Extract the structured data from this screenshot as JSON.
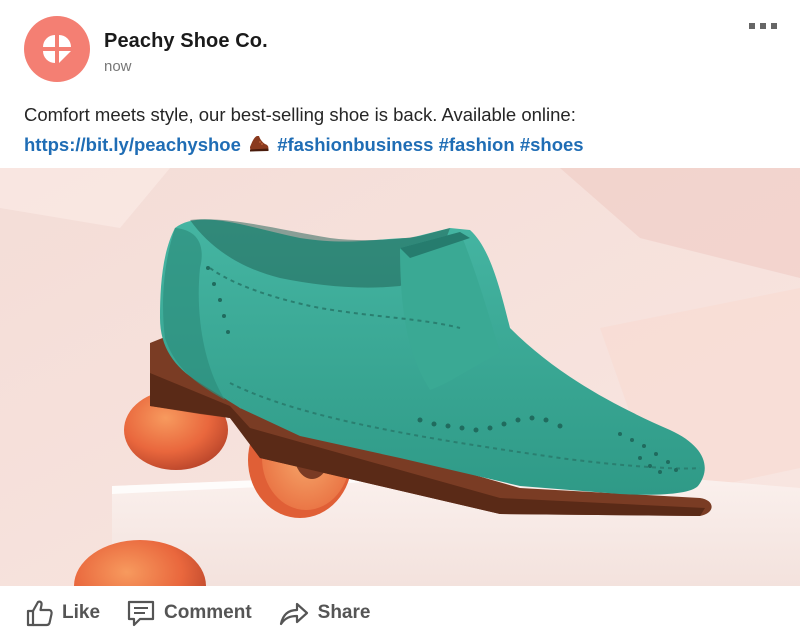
{
  "post": {
    "author": "Peachy Shoe Co.",
    "timestamp": "now",
    "caption_text": "Comfort meets style, our best-selling shoe is back. Available online:",
    "link": "https://bit.ly/peachyshoe",
    "hashtags": [
      "#fashionbusiness",
      "#fashion",
      "#shoes"
    ],
    "more_icon": "more-options-icon",
    "brand_color": "#f47f73",
    "link_color": "#1f6db5"
  },
  "image": {
    "subject": "teal suede brogue shoe resting on peach halves",
    "icons": [
      "shoe-emoji-icon"
    ]
  },
  "actions": {
    "like": "Like",
    "comment": "Comment",
    "share": "Share"
  }
}
